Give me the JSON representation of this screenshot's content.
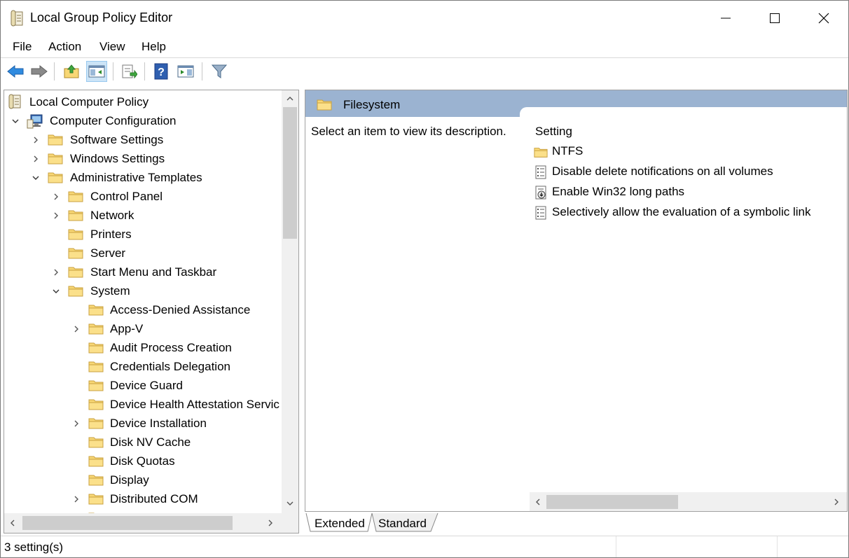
{
  "window": {
    "title": "Local Group Policy Editor"
  },
  "menu": {
    "items": [
      "File",
      "Action",
      "View",
      "Help"
    ]
  },
  "tree": {
    "items": [
      {
        "label": "Local Computer Policy"
      },
      {
        "label": "Computer Configuration"
      },
      {
        "label": "Software Settings"
      },
      {
        "label": "Windows Settings"
      },
      {
        "label": "Administrative Templates"
      },
      {
        "label": "Control Panel"
      },
      {
        "label": "Network"
      },
      {
        "label": "Printers"
      },
      {
        "label": "Server"
      },
      {
        "label": "Start Menu and Taskbar"
      },
      {
        "label": "System"
      },
      {
        "label": "Access-Denied Assistance"
      },
      {
        "label": "App-V"
      },
      {
        "label": "Audit Process Creation"
      },
      {
        "label": "Credentials Delegation"
      },
      {
        "label": "Device Guard"
      },
      {
        "label": "Device Health Attestation Servic"
      },
      {
        "label": "Device Installation"
      },
      {
        "label": "Disk NV Cache"
      },
      {
        "label": "Disk Quotas"
      },
      {
        "label": "Display"
      },
      {
        "label": "Distributed COM"
      }
    ]
  },
  "details": {
    "header_title": "Filesystem",
    "description": "Select an item to view its description.",
    "column_header": "Setting",
    "settings": [
      {
        "label": "NTFS",
        "icon": "folder-icon"
      },
      {
        "label": "Disable delete notifications on all volumes",
        "icon": "policy-setting-icon"
      },
      {
        "label": "Enable Win32 long paths",
        "icon": "policy-setting-enabled-icon"
      },
      {
        "label": "Selectively allow the evaluation of a symbolic link",
        "icon": "policy-setting-icon"
      }
    ]
  },
  "tabs": {
    "extended": "Extended",
    "standard": "Standard"
  },
  "status": {
    "text": "3 setting(s)"
  },
  "colors": {
    "header_band": "#9bb3d1",
    "folder_fill": "#f8d775",
    "selected_toolbar": "#cce4f7"
  }
}
